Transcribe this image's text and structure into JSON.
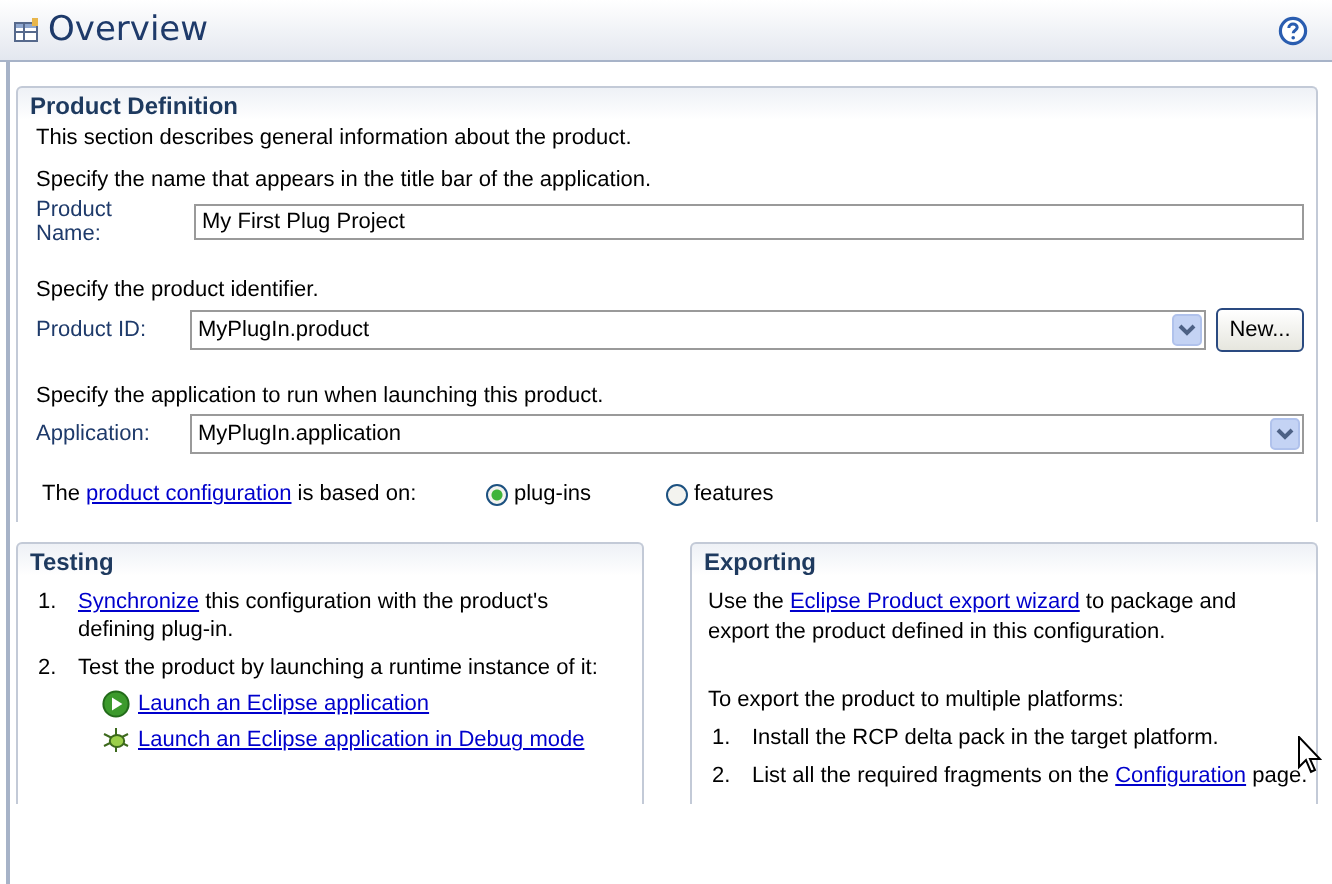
{
  "header": {
    "title": "Overview"
  },
  "product_definition": {
    "title": "Product Definition",
    "description": "This section describes general information about the product.",
    "fields": [
      {
        "kind": "text",
        "hint": "Specify the name that appears in the title bar of the application.",
        "label": "Product Name:",
        "value": "My First Plug Project"
      },
      {
        "kind": "combo",
        "hint": "Specify the product identifier.",
        "label": "Product ID:",
        "value": "MyPlugIn.product",
        "button": "New..."
      },
      {
        "kind": "combo",
        "hint": "Specify the application to run when launching this product.",
        "label": "Application:",
        "value": "MyPlugIn.application"
      }
    ],
    "based_on": {
      "parts": [
        {
          "kind": "text",
          "text": "The "
        },
        {
          "kind": "link",
          "text": "product configuration"
        },
        {
          "kind": "text",
          "text": " is based on:"
        }
      ],
      "options": [
        {
          "label": "plug-ins",
          "selected": true
        },
        {
          "label": "features",
          "selected": false
        }
      ]
    }
  },
  "testing": {
    "title": "Testing",
    "steps": [
      {
        "number": "1.",
        "parts": [
          {
            "kind": "link",
            "text": "Synchronize"
          },
          {
            "kind": "text",
            "text": " this configuration with the product's defining plug-in."
          }
        ]
      },
      {
        "number": "2.",
        "parts": [
          {
            "kind": "text",
            "text": "Test the product by launching a runtime instance of it:"
          }
        ],
        "actions": [
          {
            "kind": "run",
            "text": "Launch an Eclipse application"
          },
          {
            "kind": "debug",
            "text": "Launch an Eclipse application in Debug mode"
          }
        ]
      }
    ]
  },
  "exporting": {
    "title": "Exporting",
    "intro": [
      {
        "kind": "text",
        "text": "Use the "
      },
      {
        "kind": "link",
        "text": "Eclipse Product export wizard"
      },
      {
        "kind": "text",
        "text": " to package and export the product defined in this configuration."
      }
    ],
    "lead": "To export the product to multiple platforms:",
    "steps": [
      {
        "number": "1.",
        "parts": [
          {
            "kind": "text",
            "text": "Install the RCP delta pack in the target platform."
          }
        ]
      },
      {
        "number": "2.",
        "parts": [
          {
            "kind": "text",
            "text": "List all the required fragments on the "
          },
          {
            "kind": "link",
            "text": "Configuration"
          },
          {
            "kind": "text",
            "text": " page."
          }
        ]
      }
    ]
  }
}
